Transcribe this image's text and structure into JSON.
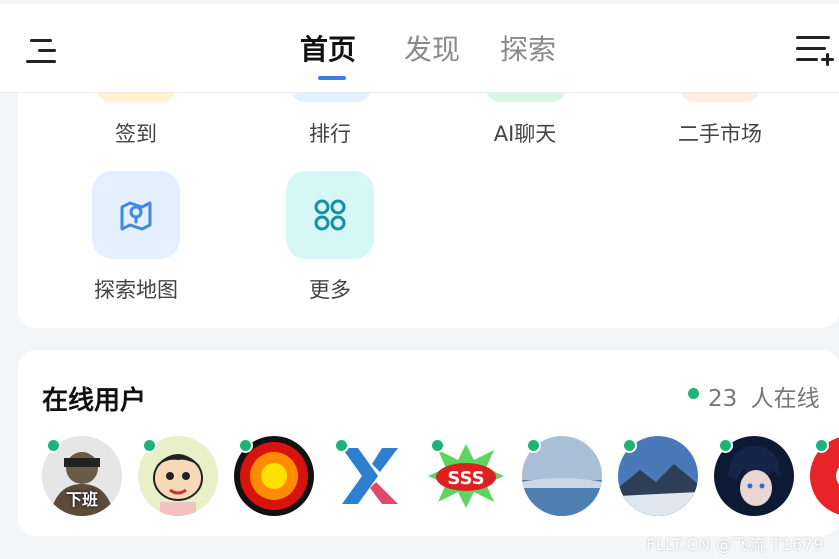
{
  "header": {
    "tabs": [
      {
        "label": "首页",
        "active": true
      },
      {
        "label": "发现",
        "active": false
      },
      {
        "label": "探索",
        "active": false
      }
    ],
    "accent_color": "#3d7ee0"
  },
  "shortcuts": {
    "row1": [
      {
        "label": "签到",
        "icon": "sign-in-icon",
        "color": "#fdf3d0"
      },
      {
        "label": "排行",
        "icon": "ranking-icon",
        "color": "#e4efff"
      },
      {
        "label": "AI聊天",
        "icon": "ai-chat-icon",
        "color": "#d9f7e6"
      },
      {
        "label": "二手市场",
        "icon": "market-icon",
        "color": "#fbeee4"
      }
    ],
    "row2": [
      {
        "label": "探索地图",
        "icon": "map-icon",
        "color": "#e4efff"
      },
      {
        "label": "更多",
        "icon": "more-grid-icon",
        "color": "#d6f7f7"
      }
    ]
  },
  "online": {
    "title": "在线用户",
    "count": "23",
    "count_suffix": "人在线",
    "status_color": "#1fb37a",
    "avatars": [
      {
        "name": "avatar-meme-xiaban",
        "caption": "下班"
      },
      {
        "name": "avatar-cartoon-boy"
      },
      {
        "name": "avatar-sunflower"
      },
      {
        "name": "avatar-x-logo"
      },
      {
        "name": "avatar-sss-sticker"
      },
      {
        "name": "avatar-sky-landscape"
      },
      {
        "name": "avatar-snow-mountain"
      },
      {
        "name": "avatar-anime-boy"
      },
      {
        "name": "avatar-red-partial"
      }
    ]
  },
  "watermark": "FLLT.CN @飞流 T1679"
}
